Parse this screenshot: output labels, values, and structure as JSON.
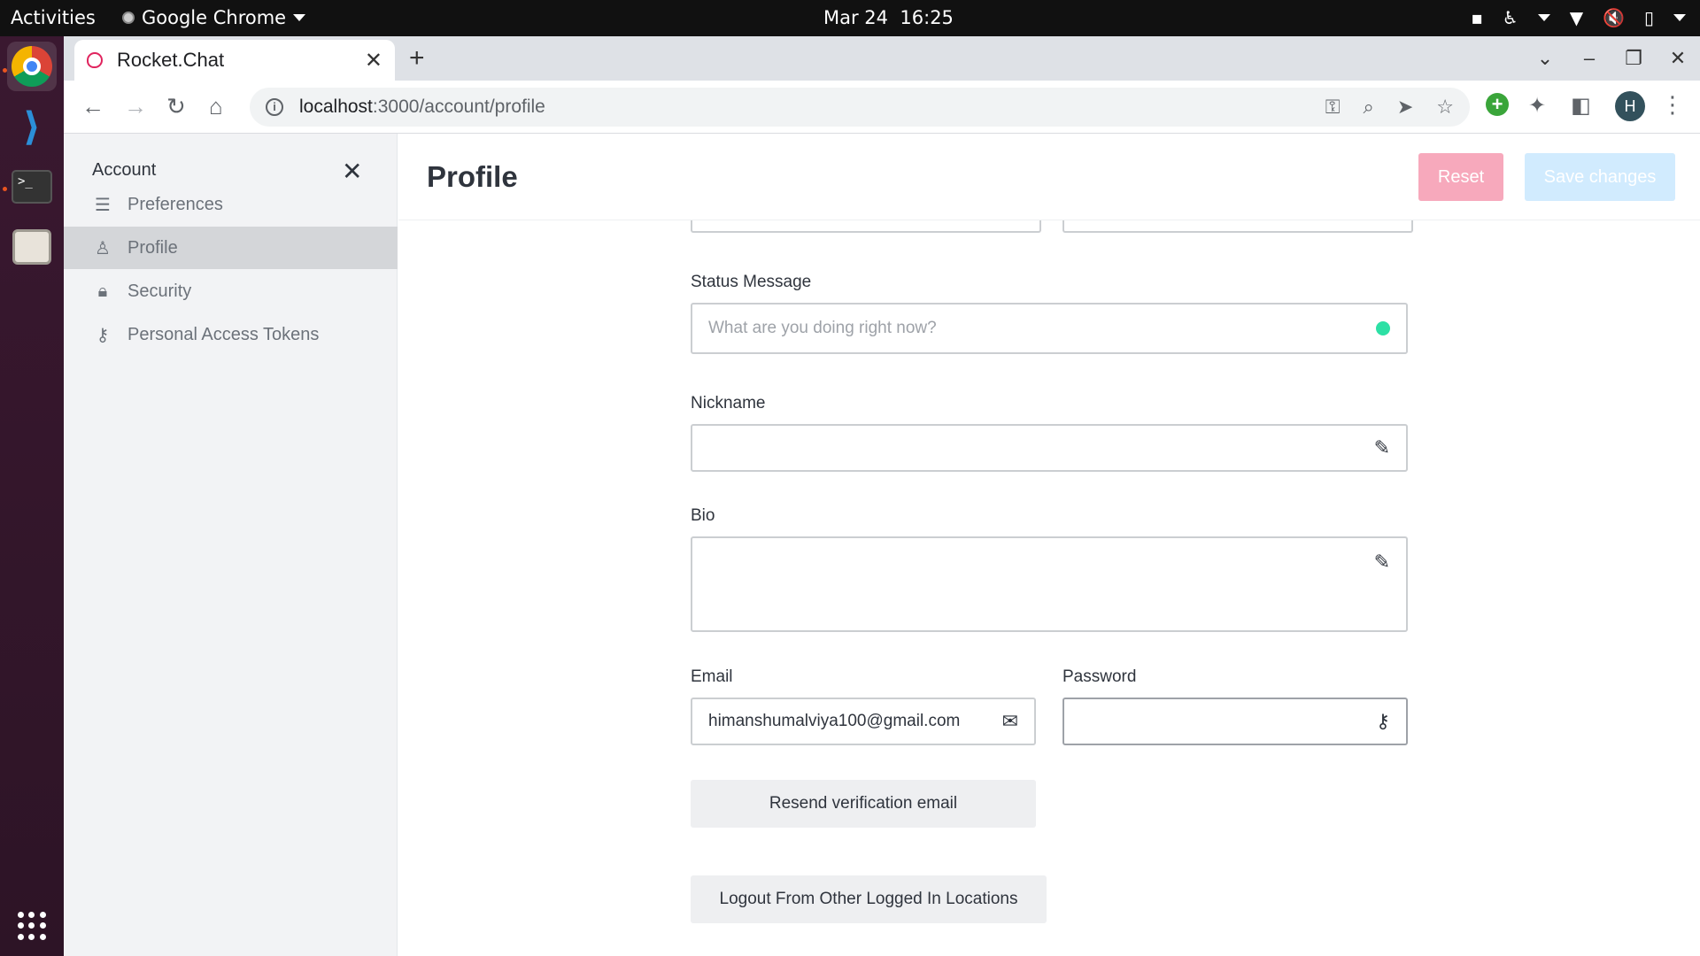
{
  "os": {
    "activities": "Activities",
    "app_name": "Google Chrome",
    "date": "Mar 24",
    "time": "16:25"
  },
  "browser": {
    "tab_title": "Rocket.Chat",
    "url_host": "localhost",
    "url_path": ":3000/account/profile",
    "profile_initial": "H"
  },
  "sidebar": {
    "title": "Account",
    "items": [
      {
        "label": "Preferences",
        "icon": "sliders-icon"
      },
      {
        "label": "Profile",
        "icon": "user-icon",
        "active": true
      },
      {
        "label": "Security",
        "icon": "lock-icon"
      },
      {
        "label": "Personal Access Tokens",
        "icon": "key-icon"
      }
    ]
  },
  "header": {
    "title": "Profile",
    "reset_label": "Reset",
    "save_label": "Save changes"
  },
  "form": {
    "status_label": "Status Message",
    "status_placeholder": "What are you doing right now?",
    "nickname_label": "Nickname",
    "nickname_value": "",
    "bio_label": "Bio",
    "bio_value": "",
    "email_label": "Email",
    "email_value": "himanshumalviya100@gmail.com",
    "password_label": "Password",
    "password_value": "",
    "resend_label": "Resend verification email",
    "logout_label": "Logout From Other Logged In Locations"
  },
  "colors": {
    "reset_bg": "#f7a9bc",
    "save_bg": "#d1ebfe",
    "status_online": "#2de0a5",
    "sidebar_active": "#d4d6d9"
  }
}
